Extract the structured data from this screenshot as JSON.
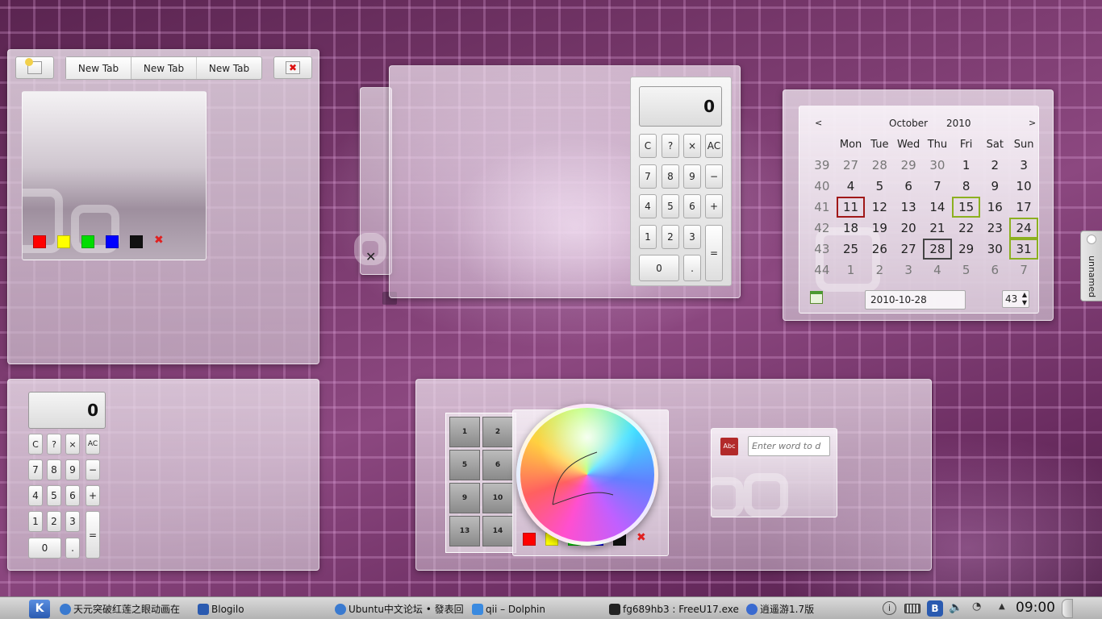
{
  "colors": {
    "red": "#ff0000",
    "yellow": "#ffff00",
    "green": "#00dd00",
    "blue": "#0000ff",
    "black": "#111111",
    "today_border": "#444444",
    "selected_border": "#a01818",
    "weekend_border": "#8cb020"
  },
  "tab_widget": {
    "tabs": [
      "New Tab",
      "New Tab",
      "New Tab"
    ],
    "add_icon": "new-tab-icon",
    "close_icon": "close-tab-icon"
  },
  "paint_colors": [
    "red",
    "yellow",
    "green",
    "blue",
    "black"
  ],
  "calc_top": {
    "display": "0",
    "rows": [
      [
        "C",
        "?",
        "×",
        "AC"
      ],
      [
        "7",
        "8",
        "9",
        "−"
      ],
      [
        "4",
        "5",
        "6",
        "+"
      ],
      [
        "1",
        "2",
        "3"
      ]
    ],
    "zero": "0",
    "dot": ".",
    "equals": "="
  },
  "calc_left": {
    "display": "0",
    "rows": [
      [
        "C",
        "?",
        "×",
        "AC"
      ],
      [
        "7",
        "8",
        "9",
        "−"
      ],
      [
        "4",
        "5",
        "6",
        "+"
      ],
      [
        "1",
        "2",
        "3"
      ]
    ],
    "zero": "0",
    "dot": ".",
    "equals": "="
  },
  "small_window": {
    "close": "✕"
  },
  "calendar": {
    "prev": "<",
    "next": ">",
    "month": "October",
    "year": "2010",
    "headers": [
      "Mon",
      "Tue",
      "Wed",
      "Thu",
      "Fri",
      "Sat",
      "Sun"
    ],
    "weeks": [
      {
        "wk": "39",
        "days": [
          "27",
          "28",
          "29",
          "30",
          "1",
          "2",
          "3"
        ]
      },
      {
        "wk": "40",
        "days": [
          "4",
          "5",
          "6",
          "7",
          "8",
          "9",
          "10"
        ]
      },
      {
        "wk": "41",
        "days": [
          "11",
          "12",
          "13",
          "14",
          "15",
          "16",
          "17"
        ]
      },
      {
        "wk": "42",
        "days": [
          "18",
          "19",
          "20",
          "21",
          "22",
          "23",
          "24"
        ]
      },
      {
        "wk": "43",
        "days": [
          "25",
          "26",
          "27",
          "28",
          "29",
          "30",
          "31"
        ]
      },
      {
        "wk": "44",
        "days": [
          "1",
          "2",
          "3",
          "4",
          "5",
          "6",
          "7"
        ]
      }
    ],
    "date_field": "2010-10-28",
    "week_spin": "43"
  },
  "side_tab": {
    "label": "unnamed"
  },
  "puzzle": {
    "tiles": [
      "1",
      "2",
      "5",
      "6",
      "9",
      "10",
      "13",
      "14"
    ]
  },
  "dictionary": {
    "placeholder": "Enter word to d",
    "icon_label": "Abc"
  },
  "taskbar": {
    "tasks": [
      "天元突破红莲之眼动画在",
      "Blogilo",
      "Ubuntu中文论坛 • 發表回",
      "qii – Dolphin",
      "fg689hb3 : FreeU17.exe",
      "逍遥游1.7版"
    ],
    "clock": "09:00"
  }
}
